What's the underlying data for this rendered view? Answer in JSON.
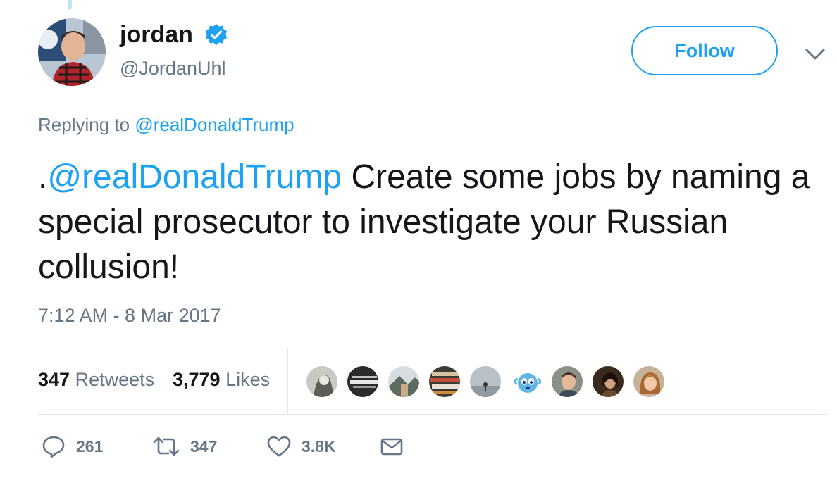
{
  "author": {
    "display_name": "jordan",
    "handle": "@JordanUhl",
    "verified": true
  },
  "follow_label": "Follow",
  "menu_icon": "chevron-down-icon",
  "reply_context": {
    "prefix": "Replying to",
    "mention": "@realDonaldTrump"
  },
  "tweet": {
    "leading_dot": ".",
    "mention": "@realDonaldTrump",
    "text": " Create some jobs by naming a special prosecutor to investigate your Russian collusion!"
  },
  "timestamp": "7:12 AM - 8 Mar 2017",
  "stats": {
    "retweets_count": "347",
    "retweets_label": "Retweets",
    "likes_count": "3,779",
    "likes_label": "Likes"
  },
  "likers_avatar_count": 9,
  "actions": {
    "replies": "261",
    "retweets": "347",
    "likes": "3.8K"
  },
  "colors": {
    "accent": "#1da1f2",
    "secondary_text": "#657786",
    "primary_text": "#14171a",
    "divider": "#e1e8ed"
  }
}
